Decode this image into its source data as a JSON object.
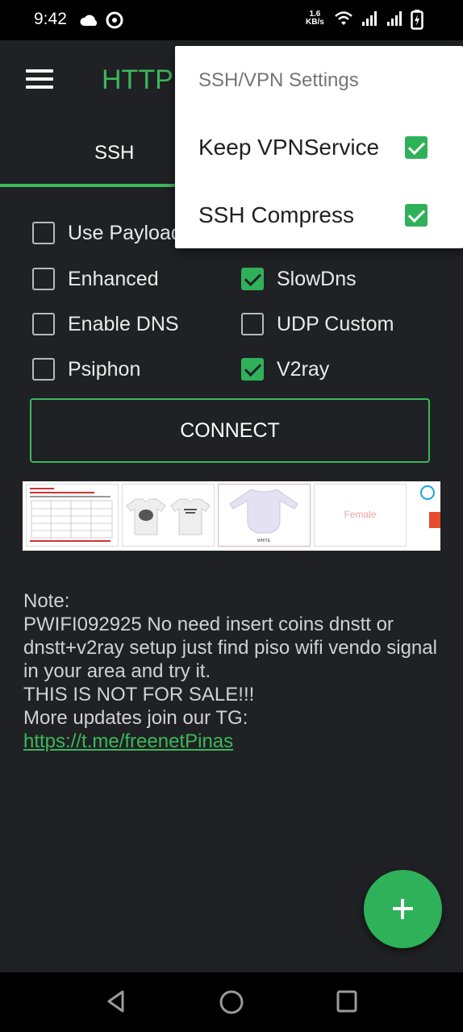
{
  "status_bar": {
    "time": "9:42",
    "net_speed_value": "1.6",
    "net_speed_unit": "KB/s"
  },
  "app_bar": {
    "title": "HTTP"
  },
  "tabs": [
    {
      "label": "SSH",
      "selected": true
    }
  ],
  "options": {
    "use_payload": {
      "label": "Use Payload",
      "checked": false
    },
    "enhanced": {
      "label": "Enhanced",
      "checked": false
    },
    "slowdns": {
      "label": "SlowDns",
      "checked": true
    },
    "enable_dns": {
      "label": "Enable DNS",
      "checked": false
    },
    "udp_custom": {
      "label": "UDP Custom",
      "checked": false
    },
    "psiphon": {
      "label": "Psiphon",
      "checked": false
    },
    "v2ray": {
      "label": "V2ray",
      "checked": true
    }
  },
  "connect_button": {
    "label": "CONNECT"
  },
  "ad": {
    "female_label": "Female",
    "white_label": "WHITE"
  },
  "note": {
    "heading": "Note:",
    "body": "PWIFI092925 No need insert coins dnstt or dnstt+v2ray setup just find piso wifi vendo signal in your area and try it.",
    "warning": "THIS IS NOT FOR SALE!!!",
    "updates_prefix": "More updates join our TG: ",
    "link": "https://t.me/freenetPinas"
  },
  "menu": {
    "title": "SSH/VPN Settings",
    "items": [
      {
        "label": "Keep VPNService",
        "checked": true
      },
      {
        "label": "SSH Compress",
        "checked": true
      }
    ]
  },
  "colors": {
    "accent": "#3cb85a",
    "background": "#1f2124",
    "checkbox_on": "#2fb15a"
  }
}
